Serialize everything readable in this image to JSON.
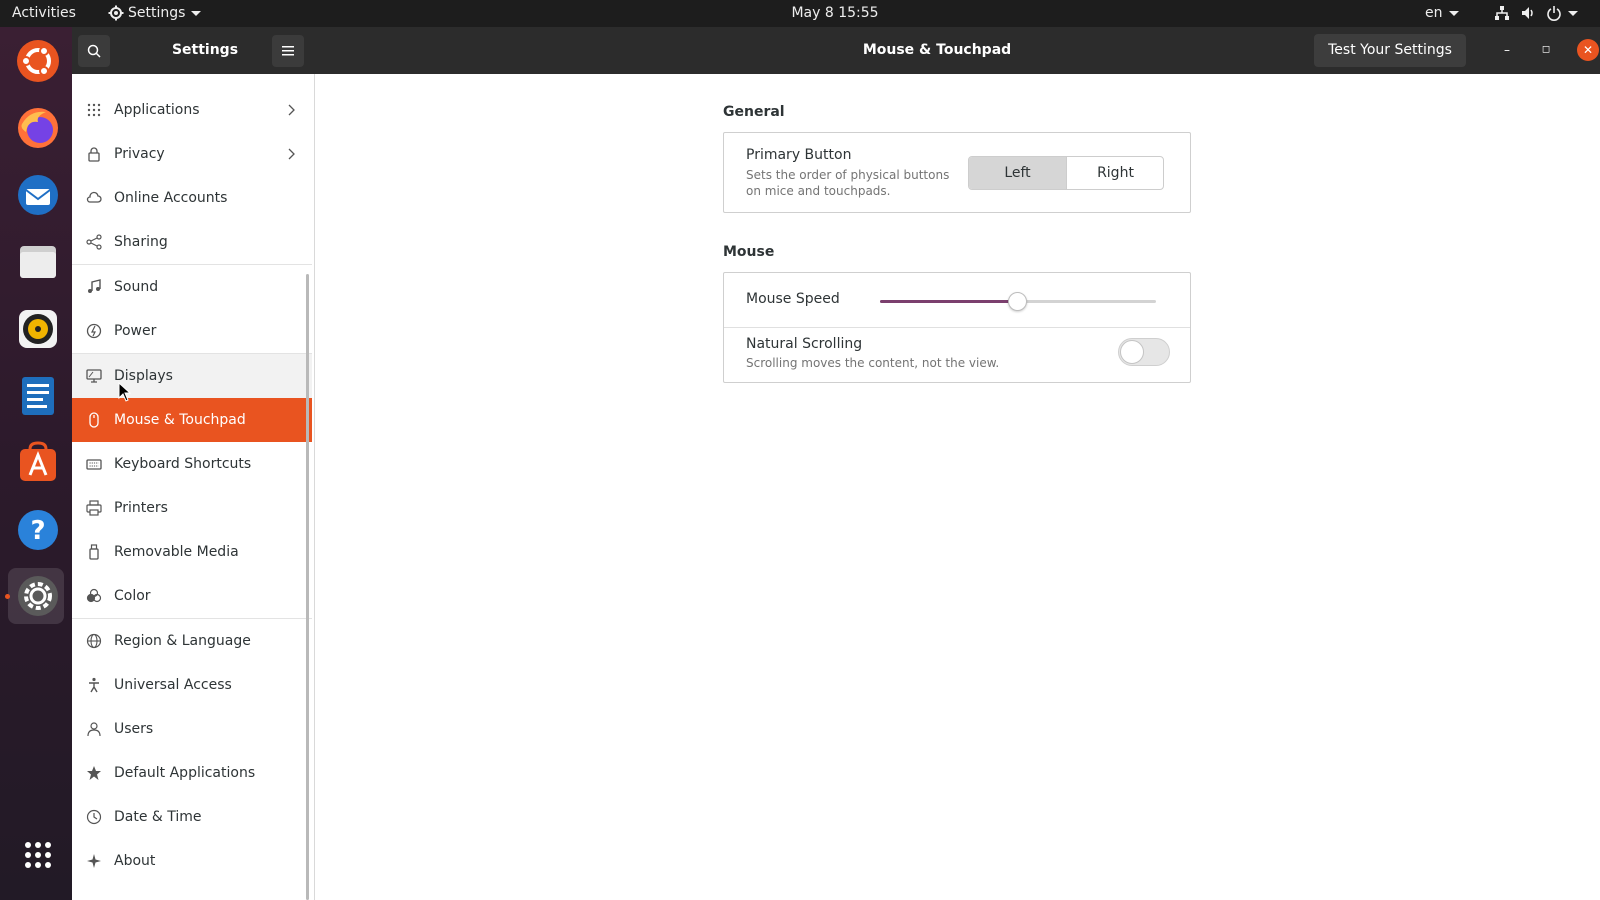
{
  "topbar": {
    "activities": "Activities",
    "app_menu": "Settings",
    "clock": "May 8  15:55",
    "language": "en"
  },
  "dock": {
    "items": [
      "ubuntu-logo",
      "firefox",
      "thunderbird",
      "files",
      "rhythmbox",
      "libreoffice-writer",
      "ubuntu-software",
      "help",
      "settings"
    ],
    "apps_grid": "show-applications"
  },
  "headerbar": {
    "sidebar_title": "Settings",
    "page_title": "Mouse & Touchpad",
    "test_button": "Test Your Settings",
    "minimize": "–",
    "maximize": "◻",
    "close": "✕"
  },
  "sidebar": {
    "items": [
      {
        "label": "Applications",
        "icon": "apps-grid-icon",
        "chevron": true
      },
      {
        "label": "Privacy",
        "icon": "lock-icon",
        "chevron": true
      },
      {
        "label": "Online Accounts",
        "icon": "cloud-icon"
      },
      {
        "label": "Sharing",
        "icon": "share-icon"
      },
      {
        "label": "Sound",
        "icon": "music-note-icon"
      },
      {
        "label": "Power",
        "icon": "power-icon"
      },
      {
        "label": "Displays",
        "icon": "display-icon"
      },
      {
        "label": "Mouse & Touchpad",
        "icon": "mouse-icon",
        "selected": true
      },
      {
        "label": "Keyboard Shortcuts",
        "icon": "keyboard-icon"
      },
      {
        "label": "Printers",
        "icon": "printer-icon"
      },
      {
        "label": "Removable Media",
        "icon": "usb-icon"
      },
      {
        "label": "Color",
        "icon": "color-icon"
      },
      {
        "label": "Region & Language",
        "icon": "globe-icon"
      },
      {
        "label": "Universal Access",
        "icon": "accessibility-icon"
      },
      {
        "label": "Users",
        "icon": "user-icon"
      },
      {
        "label": "Default Applications",
        "icon": "star-icon"
      },
      {
        "label": "Date & Time",
        "icon": "clock-icon"
      },
      {
        "label": "About",
        "icon": "sparkle-icon"
      }
    ]
  },
  "general": {
    "title": "General",
    "primary_button": {
      "label": "Primary Button",
      "description_line1": "Sets the order of physical buttons",
      "description_line2": "on mice and touchpads.",
      "options": [
        "Left",
        "Right"
      ],
      "selected": "Left"
    }
  },
  "mouse": {
    "title": "Mouse",
    "speed": {
      "label": "Mouse Speed",
      "value": 0.5
    },
    "natural_scrolling": {
      "label": "Natural Scrolling",
      "description": "Scrolling moves the content, not the view.",
      "enabled": false
    }
  },
  "colors": {
    "accent": "#e95420",
    "slider_fill": "#7b3f6e",
    "topbar": "#1d1d1d",
    "headerbar": "#2c2c2c"
  }
}
